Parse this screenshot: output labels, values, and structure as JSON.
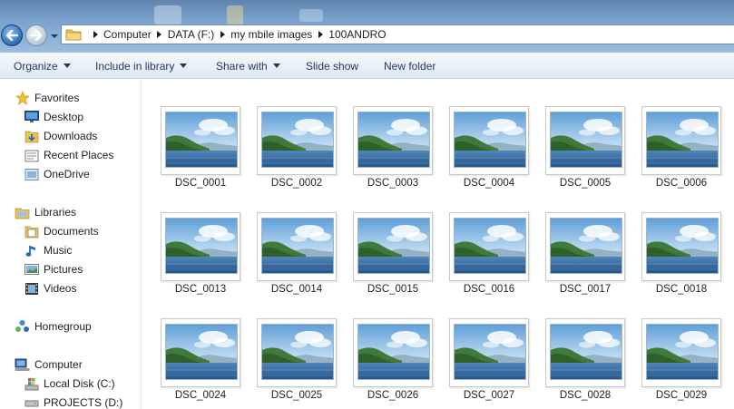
{
  "breadcrumb": [
    "Computer",
    "DATA (F:)",
    "my mbile images",
    "100ANDRO"
  ],
  "toolbar": {
    "organize": "Organize",
    "include_in_library": "Include in library",
    "share_with": "Share with",
    "slide_show": "Slide show",
    "new_folder": "New folder"
  },
  "nav": {
    "favorites": "Favorites",
    "desktop": "Desktop",
    "downloads": "Downloads",
    "recent_places": "Recent Places",
    "onedrive": "OneDrive",
    "libraries": "Libraries",
    "documents": "Documents",
    "music": "Music",
    "pictures": "Pictures",
    "videos": "Videos",
    "homegroup": "Homegroup",
    "computer": "Computer",
    "local_disk": "Local Disk (C:)",
    "projects": "PROJECTS (D:)"
  },
  "files": [
    "DSC_0001",
    "DSC_0002",
    "DSC_0003",
    "DSC_0004",
    "DSC_0005",
    "DSC_0006",
    "DSC_0013",
    "DSC_0014",
    "DSC_0015",
    "DSC_0016",
    "DSC_0017",
    "DSC_0018",
    "DSC_0024",
    "DSC_0025",
    "DSC_0026",
    "DSC_0027",
    "DSC_0028",
    "DSC_0029"
  ],
  "icons": {
    "back": "back-arrow-icon",
    "forward": "forward-arrow-icon",
    "favorites": "star-icon",
    "desktop": "desktop-icon",
    "downloads": "downloads-folder-icon",
    "recent": "recent-places-icon",
    "onedrive": "onedrive-icon",
    "libraries": "libraries-icon",
    "documents": "documents-icon",
    "music": "music-note-icon",
    "pictures": "pictures-icon",
    "videos": "film-strip-icon",
    "homegroup": "homegroup-icon",
    "computer": "computer-icon",
    "local_disk": "windows-drive-icon",
    "projects": "drive-icon"
  },
  "colors": {
    "title_bar": "#7ba3cd",
    "command_bar": "#e8eff7",
    "command_text": "#1e395b",
    "thumb_border": "#c9c9c9"
  }
}
